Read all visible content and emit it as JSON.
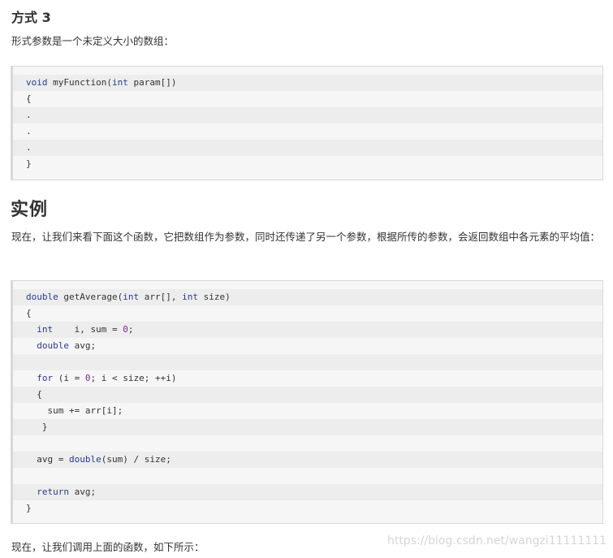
{
  "section_heading": "方式 3",
  "intro_text": "形式参数是一个未定义大小的数组：",
  "code_block_1": [
    "void myFunction(int param[])",
    "{",
    ".",
    ".",
    ".",
    "}"
  ],
  "example_heading": "实例",
  "example_text": "现在，让我们来看下面这个函数，它把数组作为参数，同时还传递了另一个参数，根据所传的参数，会返回数组中各元素的平均值：",
  "code_block_2": [
    "double getAverage(int arr[], int size)",
    "{",
    "  int    i, sum = 0;",
    "  double avg;",
    "",
    "  for (i = 0; i < size; ++i)",
    "  {",
    "    sum += arr[i];",
    "   }",
    "",
    "  avg = double(sum) / size;",
    "",
    "  return avg;",
    "}"
  ],
  "footer_text": "现在，让我们调用上面的函数，如下所示：",
  "watermark": "https://blog.csdn.net/wangzi11111111"
}
